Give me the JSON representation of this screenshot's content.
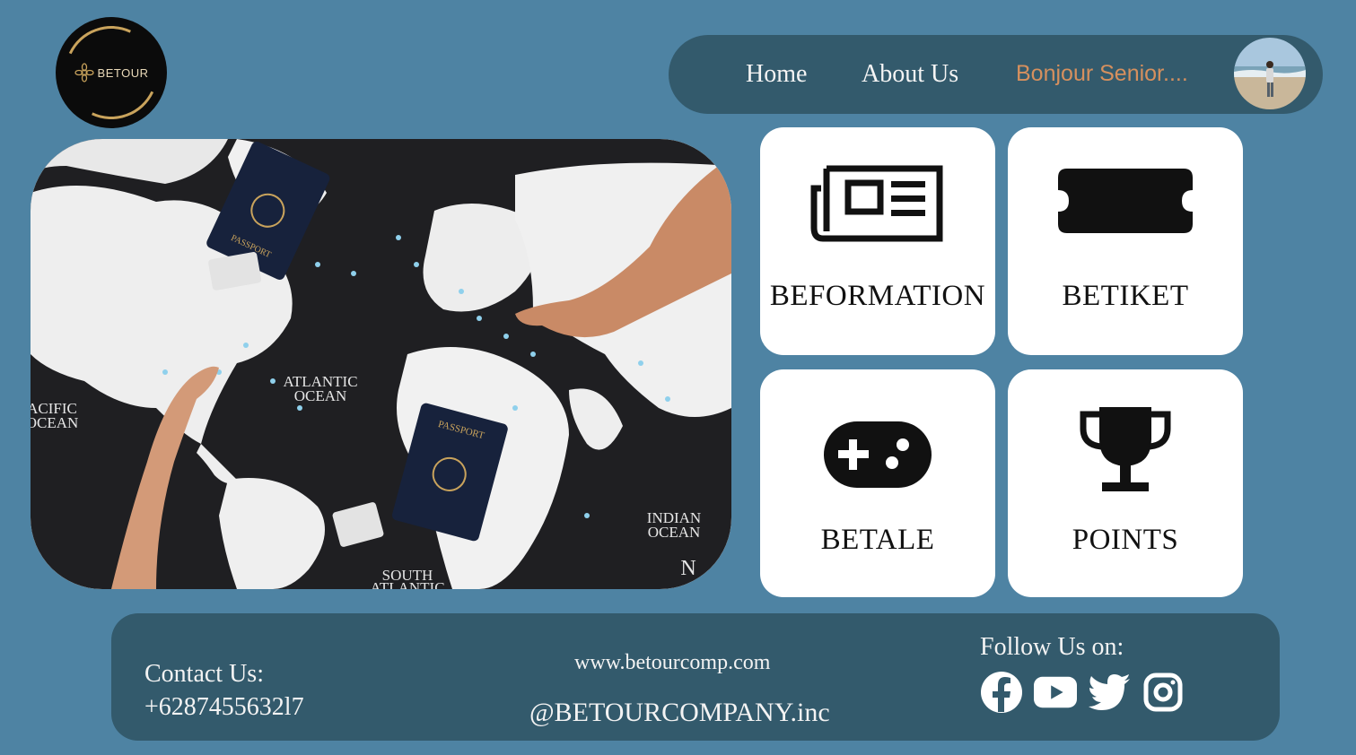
{
  "brand": {
    "logo_text": "BETOUR",
    "accent_gold": "#c9a35c"
  },
  "nav": {
    "home": "Home",
    "about": "About Us",
    "user": "Bonjour Senior....",
    "user_color": "#d6905e"
  },
  "hero": {
    "labels": {
      "atlantic_1": "ATLANTIC",
      "atlantic_2": "OCEAN",
      "pacific_1": "ACIFIC",
      "pacific_2": "OCEAN",
      "indian_1": "INDIAN",
      "indian_2": "OCEAN",
      "south_1": "SOUTH",
      "south_2": "ATLANTIC",
      "north": "N",
      "passport": "PASSPORT"
    }
  },
  "cards": [
    {
      "label": "BEFORMATION",
      "icon": "newspaper-icon"
    },
    {
      "label": "BETIKET",
      "icon": "ticket-icon"
    },
    {
      "label": "BETALE",
      "icon": "gamepad-icon"
    },
    {
      "label": "POINTS",
      "icon": "trophy-icon"
    }
  ],
  "footer": {
    "contact_title": "Contact Us:",
    "contact_phone": "+6287455632l7",
    "website": "www.betourcomp.com",
    "handle": "@BETOURCOMPANY.inc",
    "follow_title": "Follow Us on:",
    "socials": [
      "facebook-icon",
      "youtube-icon",
      "twitter-icon",
      "instagram-icon"
    ]
  },
  "colors": {
    "background": "#4e83a3",
    "bar": "#335a6c",
    "card": "#ffffff"
  }
}
